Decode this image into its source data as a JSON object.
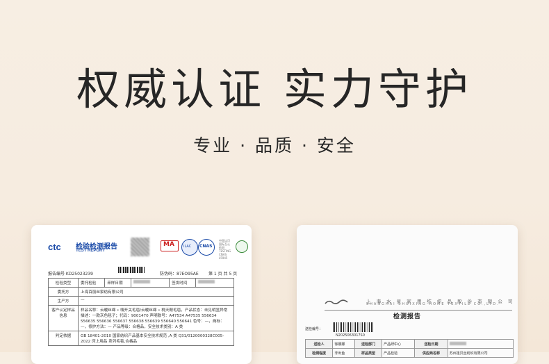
{
  "hero": {
    "title": "权威认证 实力守护",
    "subtitle": "专业 · 品质 · 安全"
  },
  "cert_left": {
    "logo_mark": "ctc",
    "logo_cn": "检验检测报告",
    "logo_en": "TEST REPORT",
    "badge_ma": "MA",
    "badge_cnas": "CNAS",
    "badge_ilac": "ILAC",
    "badge_testing": "中国认可 国际互认 检测 TESTING CNAS L5945",
    "report_no": "报告编号 KD25023239",
    "dec_no": "防伪码：87EO95AE",
    "page_no": "第 1 页 共 5 页",
    "rows": [
      {
        "label": "检验类型",
        "c1": "委托检验",
        "c2": "来样日期",
        "c3": "签发时间"
      },
      {
        "label": "委托方",
        "value": "上海百丽丝家纺有限公司"
      },
      {
        "label": "生产方",
        "value": "—"
      },
      {
        "label": "客户认定样品信息",
        "value": "样品名称：云暖丝绵 • 嗖开关毛毯/云暖丝绵 • 桃天鞍毛毯，产品状态：未见明显异常 描述：一款灰色毯子；代码：9001470 声明款号：A47534 A47535 556634 556635 556636 556637 556638 556639 556640 556641 色号：—，商标：—，修护方法：— 产品等级：合格品，安全技术类别：A 类"
      },
      {
        "label": "判定依据",
        "value": "GB 18401-2010 国家纺织产品基本安全技术规范 ,A 类 Q31/0120000328C005-2022 床上用品  系列毛毯,合格品"
      }
    ]
  },
  "cert_right": {
    "company_cn": "上 海 水 星 家 用 纺 织 品 股 份 有 限 公 司",
    "company_en": "SHANGHAI SHUIXING HOME TEXTILE CO.,LTD.",
    "title": "检测报告",
    "report_no_label": "送检编号：",
    "barcode_number": "N2025063017S0",
    "table": [
      [
        "送检人",
        "徐娜娜",
        "送检部门",
        "产品研中心",
        "送检日期",
        ""
      ],
      [
        "检测程度",
        "非出鱼",
        "样品类型",
        "产品检验",
        "供应商名称",
        "苏州祖贝丝纺织有限公司"
      ]
    ]
  },
  "colors": {
    "background": "#f6ece0",
    "title_text": "#262626",
    "ctc_blue": "#1a4aa8",
    "ma_red": "#cc2222"
  }
}
